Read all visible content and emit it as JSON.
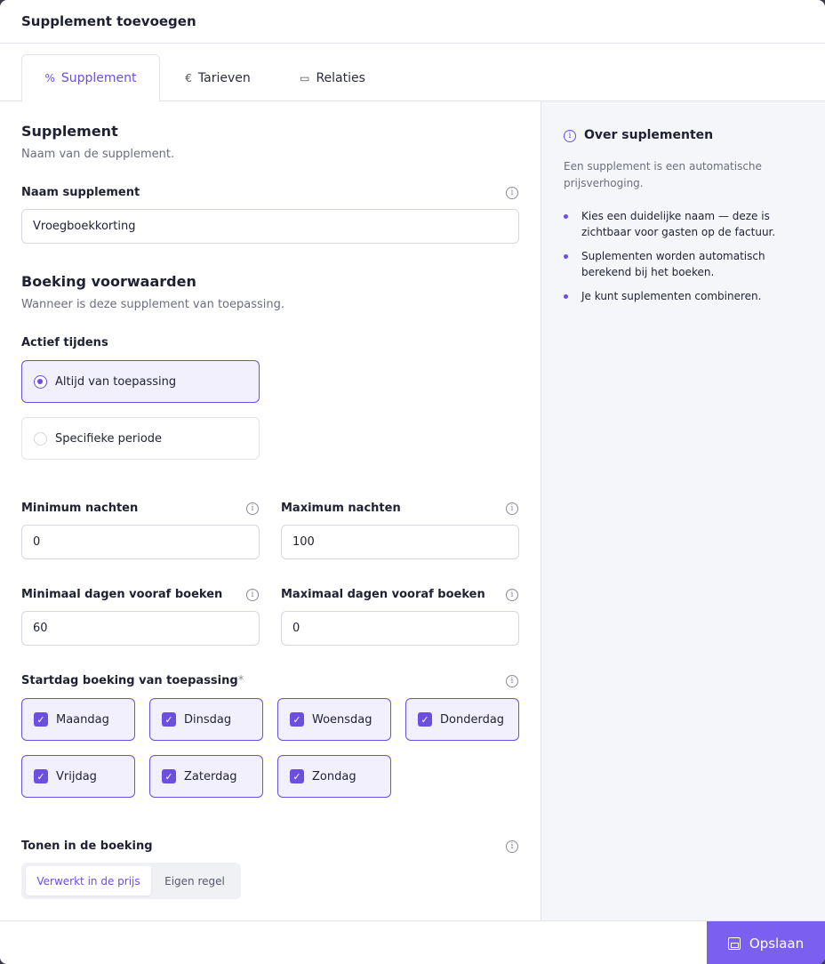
{
  "modal": {
    "title": "Supplement toevoegen"
  },
  "tabs": [
    {
      "label": "Supplement",
      "icon": "percent-icon",
      "glyph": "%"
    },
    {
      "label": "Tarieven",
      "icon": "euro-icon",
      "glyph": "€"
    },
    {
      "label": "Relaties",
      "icon": "calendar-icon",
      "glyph": "▭"
    }
  ],
  "section_supplement": {
    "title": "Supplement",
    "subtitle": "Naam van de supplement.",
    "name_label": "Naam supplement",
    "name_value": "Vroegboekkorting"
  },
  "section_booking": {
    "title": "Boeking voorwaarden",
    "subtitle": "Wanneer is deze supplement van toepassing.",
    "active_label": "Actief tijdens",
    "options": [
      "Altijd van toepassing",
      "Specifieke periode"
    ],
    "selected": "Altijd van toepassing"
  },
  "nights": {
    "min_label": "Minimum nachten",
    "min_value": "0",
    "max_label": "Maximum nachten",
    "max_value": "100"
  },
  "advance": {
    "min_label": "Minimaal dagen vooraf boeken",
    "min_value": "60",
    "max_label": "Maximaal dagen vooraf boeken",
    "max_value": "0"
  },
  "startday": {
    "label": "Startdag boeking van toepassing",
    "required_mark": "*",
    "days": [
      "Maandag",
      "Dinsdag",
      "Woensdag",
      "Donderdag",
      "Vrijdag",
      "Zaterdag",
      "Zondag"
    ]
  },
  "display": {
    "label": "Tonen in de boeking",
    "options": [
      "Verwerkt in de prijs",
      "Eigen regel"
    ],
    "selected": "Verwerkt in de prijs"
  },
  "aside": {
    "title": "Over suplementen",
    "text": "Een supplement is een automatische prijsverhoging.",
    "bullets": [
      "Kies een duidelijke naam — deze is zichtbaar voor gasten op de factuur.",
      "Suplementen worden automatisch berekend bij het boeken.",
      "Je kunt suplementen combineren."
    ]
  },
  "footer": {
    "save_label": "Opslaan"
  },
  "colors": {
    "accent": "#6c4fe0",
    "save_button": "#7a5ff0"
  }
}
